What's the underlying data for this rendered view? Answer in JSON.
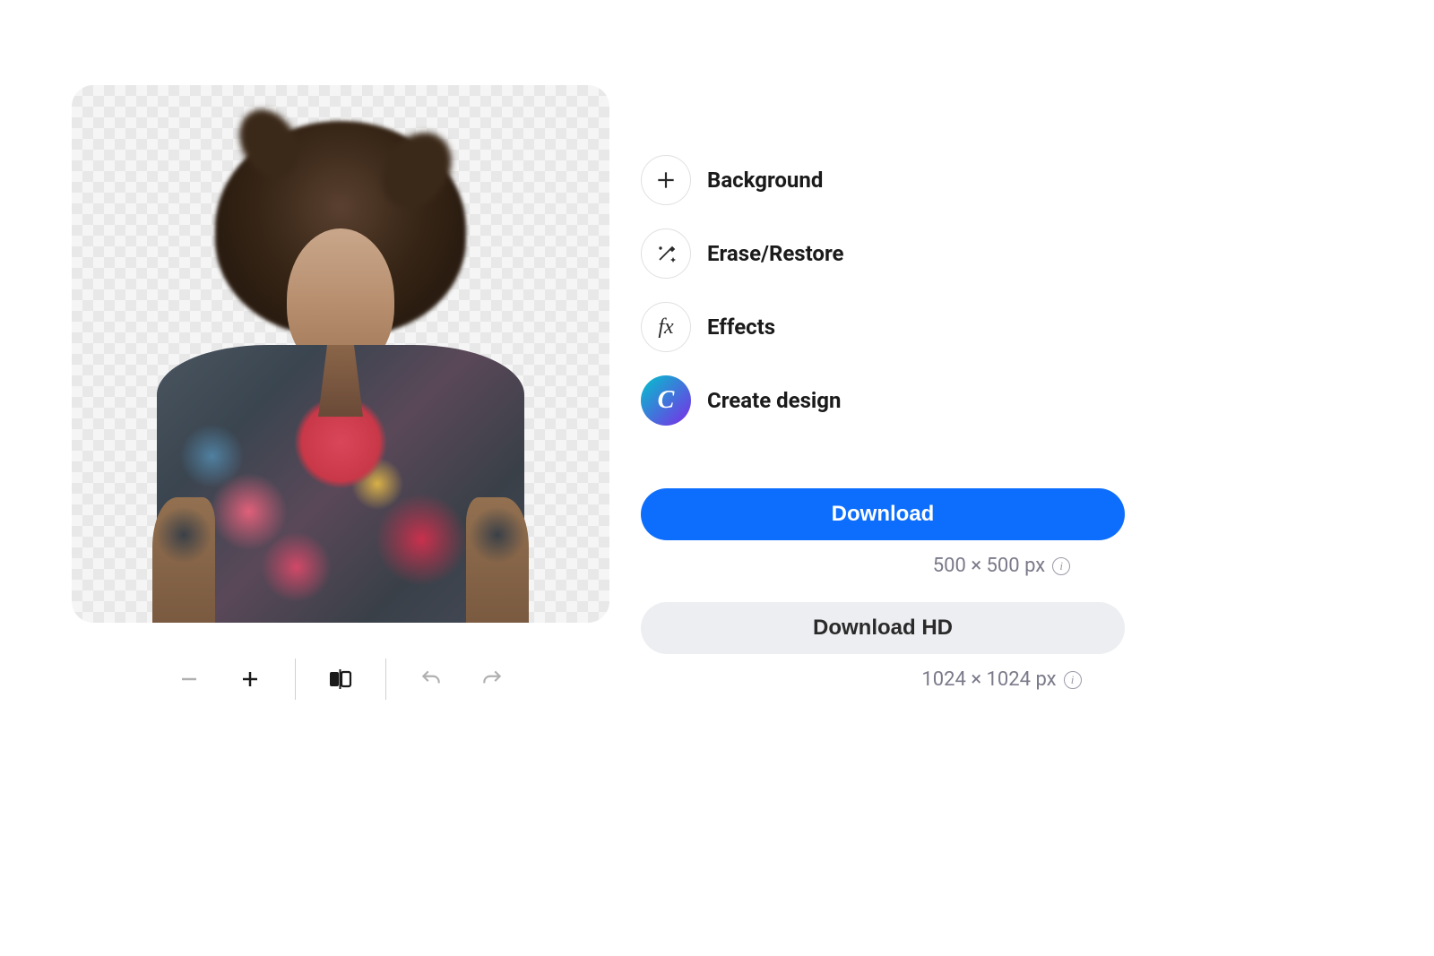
{
  "tools": {
    "background": {
      "label": "Background",
      "icon": "plus-icon"
    },
    "erase_restore": {
      "label": "Erase/Restore",
      "icon": "magic-wand-icon"
    },
    "effects": {
      "label": "Effects",
      "icon": "fx-icon"
    },
    "create_design": {
      "label": "Create design",
      "icon": "canva-icon"
    }
  },
  "downloads": {
    "standard": {
      "label": "Download",
      "size": "500 × 500 px"
    },
    "hd": {
      "label": "Download HD",
      "size": "1024 × 1024 px"
    }
  },
  "toolbar": {
    "zoom_out": "zoom-out",
    "zoom_in": "zoom-in",
    "compare": "compare",
    "undo": "undo",
    "redo": "redo"
  },
  "info_glyph": "i",
  "canva_glyph": "C",
  "fx_glyph": "fx"
}
